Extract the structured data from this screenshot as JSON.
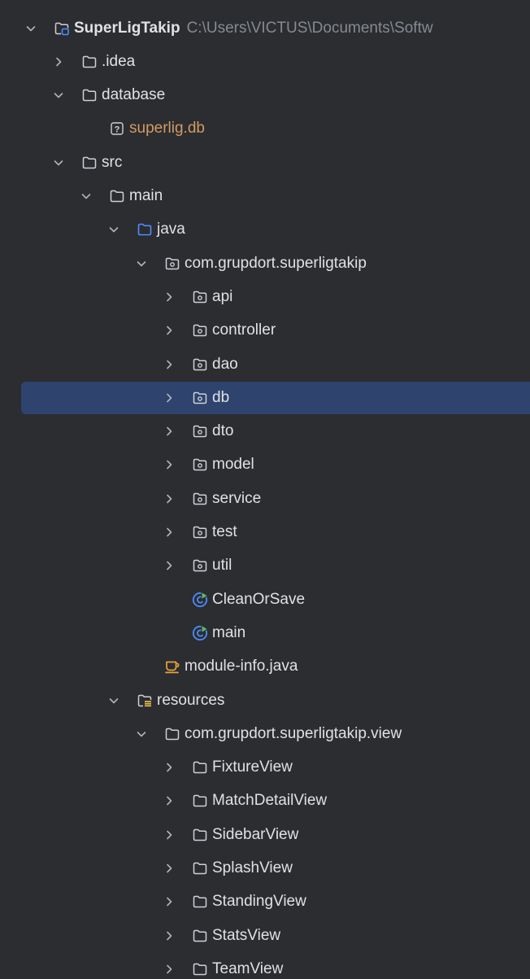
{
  "tree": {
    "items": [
      {
        "label": "SuperLigTakip",
        "secondary": "C:\\Users\\VICTUS\\Documents\\Softw",
        "icon": "project-module-icon",
        "expanded": true
      },
      {
        "label": ".idea",
        "icon": "folder-icon",
        "expanded": false
      },
      {
        "label": "database",
        "icon": "folder-icon",
        "expanded": true
      },
      {
        "label": "superlig.db",
        "icon": "unknown-file-icon",
        "color": "#d19a66"
      },
      {
        "label": "src",
        "icon": "folder-icon",
        "expanded": true
      },
      {
        "label": "main",
        "icon": "folder-icon",
        "expanded": true
      },
      {
        "label": "java",
        "icon": "source-root-folder-icon",
        "expanded": true
      },
      {
        "label": "com.grupdort.superligtakip",
        "icon": "package-icon",
        "expanded": true
      },
      {
        "label": "api",
        "icon": "package-icon",
        "expanded": false
      },
      {
        "label": "controller",
        "icon": "package-icon",
        "expanded": false
      },
      {
        "label": "dao",
        "icon": "package-icon",
        "expanded": false
      },
      {
        "label": "db",
        "icon": "package-icon",
        "expanded": false,
        "selected": true
      },
      {
        "label": "dto",
        "icon": "package-icon",
        "expanded": false
      },
      {
        "label": "model",
        "icon": "package-icon",
        "expanded": false
      },
      {
        "label": "service",
        "icon": "package-icon",
        "expanded": false
      },
      {
        "label": "test",
        "icon": "package-icon",
        "expanded": false
      },
      {
        "label": "util",
        "icon": "package-icon",
        "expanded": false
      },
      {
        "label": "CleanOrSave",
        "icon": "java-class-runnable-icon"
      },
      {
        "label": "main",
        "icon": "java-class-runnable-icon"
      },
      {
        "label": "module-info.java",
        "icon": "java-module-info-icon"
      },
      {
        "label": "resources",
        "icon": "resources-root-folder-icon",
        "expanded": true
      },
      {
        "label": "com.grupdort.superligtakip.view",
        "icon": "folder-icon",
        "expanded": true
      },
      {
        "label": "FixtureView",
        "icon": "folder-icon",
        "expanded": false
      },
      {
        "label": "MatchDetailView",
        "icon": "folder-icon",
        "expanded": false
      },
      {
        "label": "SidebarView",
        "icon": "folder-icon",
        "expanded": false
      },
      {
        "label": "SplashView",
        "icon": "folder-icon",
        "expanded": false
      },
      {
        "label": "StandingView",
        "icon": "folder-icon",
        "expanded": false
      },
      {
        "label": "StatsView",
        "icon": "folder-icon",
        "expanded": false
      },
      {
        "label": "TeamView",
        "icon": "folder-icon",
        "expanded": false
      }
    ]
  },
  "colors": {
    "background": "#2b2d30",
    "selection": "#2e436e",
    "text": "#dfe1e5",
    "secondary_text": "#868a91",
    "unversioned_text": "#d19a66",
    "source_root_blue": "#4e8cff",
    "runnable_green": "#5fb865",
    "module_info_orange": "#e8a33d"
  }
}
